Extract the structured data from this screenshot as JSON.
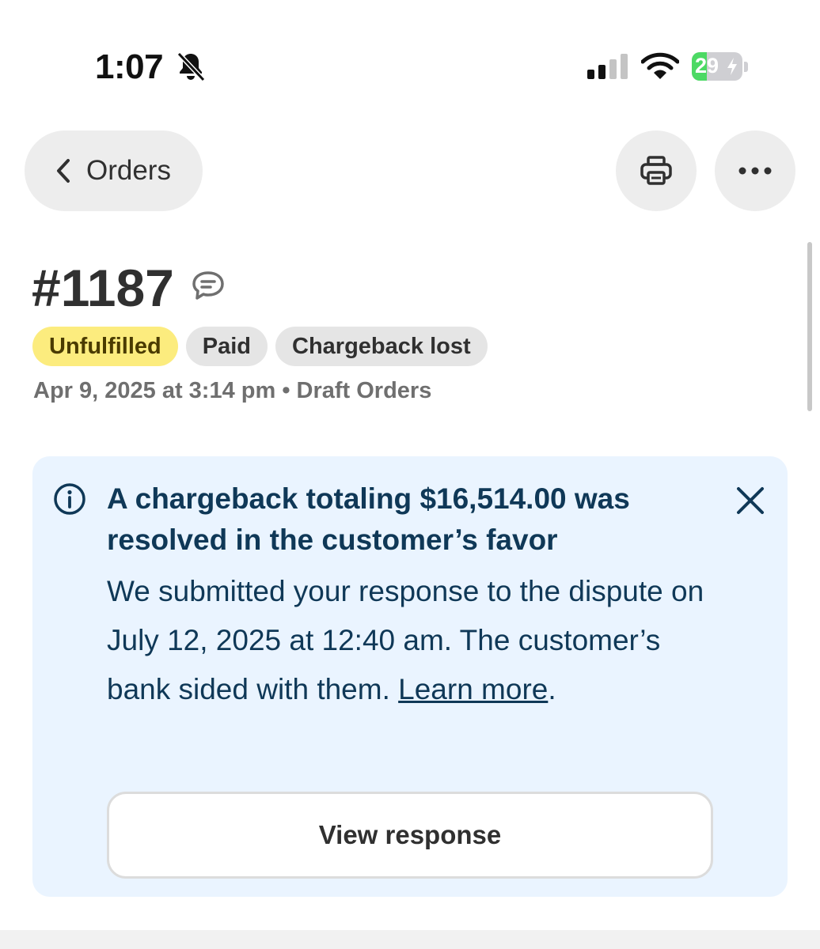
{
  "status_bar": {
    "time": "1:07",
    "battery_level": "29",
    "battery_fraction": 0.29,
    "icons": [
      "bell-off-icon",
      "cellular-signal-icon",
      "wifi-icon",
      "battery-icon"
    ]
  },
  "nav": {
    "back_label": "Orders",
    "icons": [
      "chevron-left-icon",
      "printer-icon",
      "more-horizontal-icon"
    ]
  },
  "order": {
    "number": "#1187",
    "badges": [
      "Unfulfilled",
      "Paid",
      "Chargeback lost"
    ],
    "meta": "Apr 9, 2025 at 3:14 pm • Draft Orders"
  },
  "banner": {
    "title": "A chargeback totaling $16,514.00 was resolved in the customer’s favor",
    "body": "We submitted your response to the dispute on July 12, 2025 at 12:40 am. The customer’s bank sided with them.",
    "link_label": "Learn more",
    "link_suffix": ".",
    "button_label": "View response"
  },
  "colors": {
    "banner_bg": "#eaf4ff",
    "banner_text": "#0f3857",
    "badge_yellow": "#fcec7e",
    "badge_gray": "#e5e5e5",
    "battery_green": "#4cd964"
  }
}
